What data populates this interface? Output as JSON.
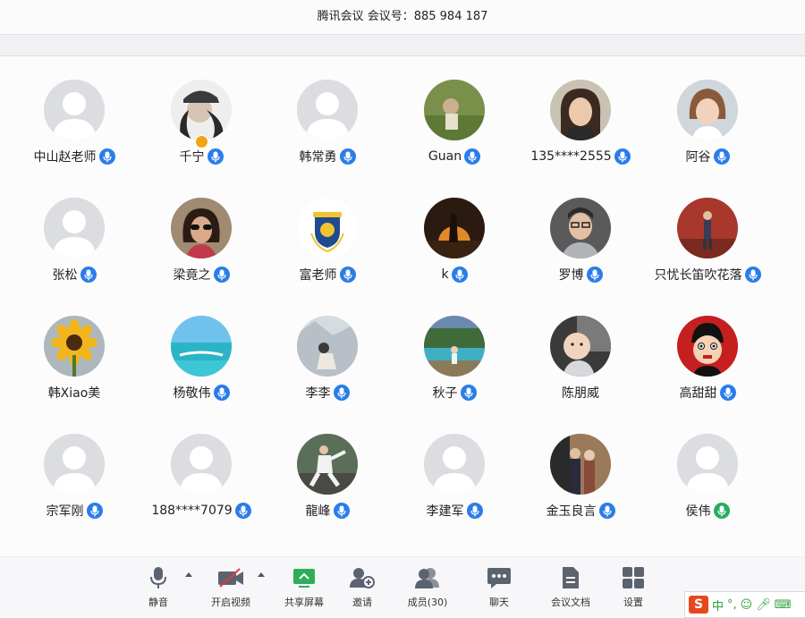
{
  "title": "腾讯会议 会议号：885 984 187",
  "participants": [
    {
      "name": "中山赵老师",
      "avatar": "default",
      "mic": "blue"
    },
    {
      "name": "千宁",
      "avatar": "photo-cap",
      "mic": "blue",
      "host": true
    },
    {
      "name": "韩常勇",
      "avatar": "default",
      "mic": "blue"
    },
    {
      "name": "Guan",
      "avatar": "photo-green",
      "mic": "blue"
    },
    {
      "name": "135****2555",
      "avatar": "photo-woman",
      "mic": "blue"
    },
    {
      "name": "阿谷",
      "avatar": "photo-woman2",
      "mic": "blue"
    },
    {
      "name": "张松",
      "avatar": "default",
      "mic": "blue"
    },
    {
      "name": "梁竟之",
      "avatar": "photo-sunglasses",
      "mic": "blue"
    },
    {
      "name": "富老师",
      "avatar": "logo-crest",
      "mic": "blue"
    },
    {
      "name": "k",
      "avatar": "photo-sunset",
      "mic": "blue"
    },
    {
      "name": "罗博",
      "avatar": "photo-man-glasses",
      "mic": "blue"
    },
    {
      "name": "只忧长笛吹花落",
      "avatar": "photo-red",
      "mic": "blue"
    },
    {
      "name": "韩Xiao美",
      "avatar": "photo-sunflower",
      "mic": "none"
    },
    {
      "name": "杨敬伟",
      "avatar": "photo-beach",
      "mic": "blue"
    },
    {
      "name": "李李",
      "avatar": "photo-snow",
      "mic": "blue"
    },
    {
      "name": "秋子",
      "avatar": "photo-lake",
      "mic": "blue"
    },
    {
      "name": "陈朋威",
      "avatar": "photo-baby",
      "mic": "none"
    },
    {
      "name": "高甜甜",
      "avatar": "cartoon",
      "mic": "blue"
    },
    {
      "name": "宗军刚",
      "avatar": "default",
      "mic": "blue"
    },
    {
      "name": "188****7079",
      "avatar": "default",
      "mic": "blue"
    },
    {
      "name": "龍峰",
      "avatar": "photo-taichi",
      "mic": "blue"
    },
    {
      "name": "李建军",
      "avatar": "default",
      "mic": "blue"
    },
    {
      "name": "金玉良言",
      "avatar": "photo-couple",
      "mic": "blue"
    },
    {
      "name": "侯伟",
      "avatar": "default",
      "mic": "green"
    }
  ],
  "toolbar": {
    "mute": "静音",
    "video": "开启视频",
    "share": "共享屏幕",
    "invite": "邀请",
    "members": "成员(30)",
    "chat": "聊天",
    "docs": "会议文档",
    "settings": "设置"
  },
  "ime": {
    "logo": "S",
    "mode": "中"
  },
  "colors": {
    "mic_blue": "#2a7de9",
    "mic_green": "#27ae60",
    "share_green": "#2fae5a",
    "video_off_red": "#e03b3b"
  }
}
